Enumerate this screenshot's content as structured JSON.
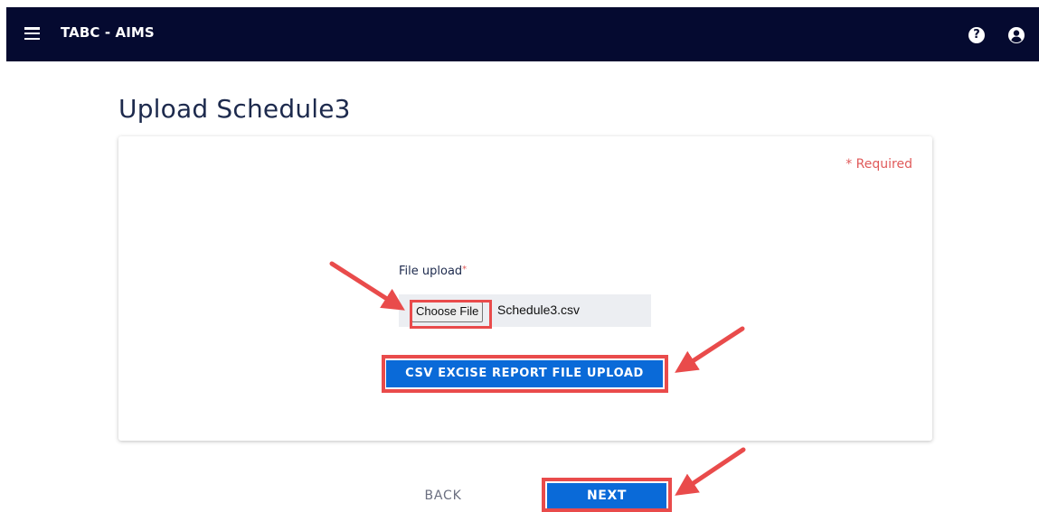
{
  "header": {
    "app_title": "TABC - AIMS",
    "menu_icon": "hamburger-menu-icon",
    "help_icon": "question-circle-icon",
    "user_icon": "user-circle-icon",
    "help_glyph": "?"
  },
  "page": {
    "title": "Upload Schedule3"
  },
  "form": {
    "required_note": "* Required",
    "file_upload_label": "File upload",
    "required_marker": "*",
    "choose_file_label": "Choose File",
    "file_name": "Schedule3.csv",
    "csv_upload_button": "CSV EXCISE REPORT FILE UPLOAD"
  },
  "nav": {
    "back_label": "BACK",
    "next_label": "NEXT"
  },
  "colors": {
    "topbar": "#050a30",
    "primary_button": "#0a6ad8",
    "required": "#e05a5a",
    "annotation": "#e94b4b"
  }
}
